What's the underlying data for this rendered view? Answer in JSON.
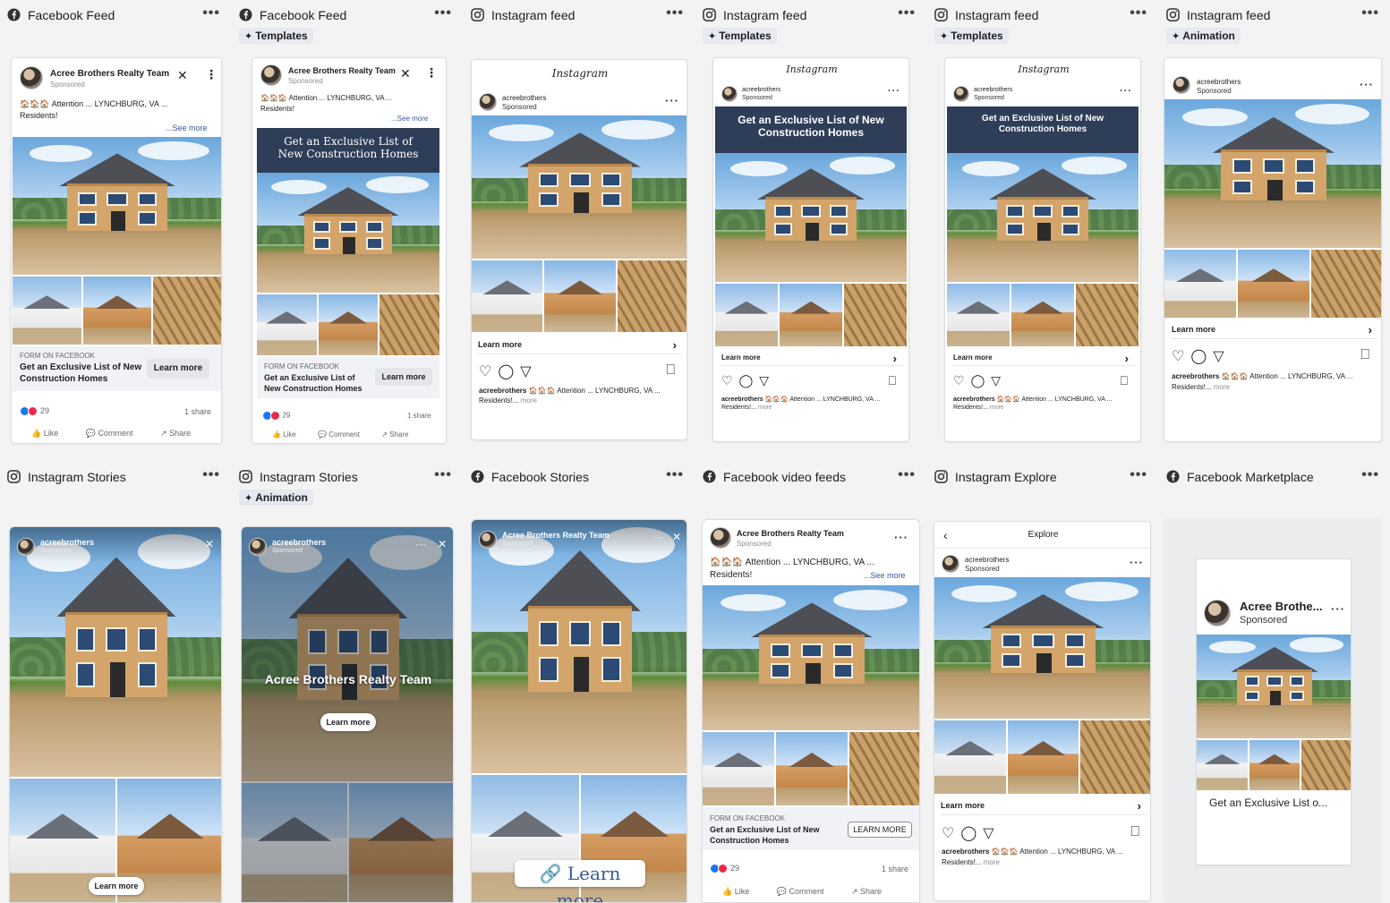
{
  "placements": [
    {
      "title": "Facebook Feed",
      "platform": "facebook",
      "tag": ""
    },
    {
      "title": "Facebook Feed",
      "platform": "facebook",
      "tag": "Templates"
    },
    {
      "title": "Instagram feed",
      "platform": "instagram",
      "tag": ""
    },
    {
      "title": "Instagram feed",
      "platform": "instagram",
      "tag": "Templates"
    },
    {
      "title": "Instagram feed",
      "platform": "instagram",
      "tag": "Templates"
    },
    {
      "title": "Instagram feed",
      "platform": "instagram",
      "tag": "Animation"
    },
    {
      "title": "Instagram Stories",
      "platform": "instagram",
      "tag": ""
    },
    {
      "title": "Instagram Stories",
      "platform": "instagram",
      "tag": "Animation"
    },
    {
      "title": "Facebook Stories",
      "platform": "facebook",
      "tag": ""
    },
    {
      "title": "Facebook video feeds",
      "platform": "facebook",
      "tag": ""
    },
    {
      "title": "Instagram Explore",
      "platform": "instagram",
      "tag": ""
    },
    {
      "title": "Facebook Marketplace",
      "platform": "facebook",
      "tag": ""
    }
  ],
  "more_glyph": "•••",
  "ad": {
    "page_name": "Acree Brothers Realty Team",
    "page_name_short": "Acree Brothe...",
    "ig_handle": "acreebrothers",
    "sponsored": "Sponsored",
    "primary_text": "Attention ... LYNCHBURG, VA ...",
    "primary_text_2": "Residents!",
    "emoji": "🏠🏠🏠",
    "see_more": "...See more",
    "ig_more": "more",
    "headline": "Get an Exclusive List of New Construction Homes",
    "headline_short": "Get an Exclusive List o...",
    "form_label": "FORM ON FACEBOOK",
    "cta": "Learn more",
    "cta_upper": "LEARN MORE",
    "reactions_count": "29",
    "shares": "1 share",
    "like": "Like",
    "comment": "Comment",
    "share": "Share",
    "ig_caption": "Attention ... LYNCHBURG, VA ...",
    "ig_caption_2": "Residents!...",
    "instagram_wordmark": "Instagram",
    "explore_title": "Explore"
  },
  "colors": {
    "facebook_blue": "#1877f2",
    "love_red": "#f02849",
    "banner_navy": "#2f3e58",
    "link_blue": "#385898",
    "panel_bg": "#f3f3f3"
  },
  "icons": {
    "facebook": "facebook-icon",
    "instagram": "instagram-icon",
    "templates": "sparkle-icon",
    "animation": "sparkle-icon",
    "close": "close-icon",
    "heart": "heart-icon",
    "comment": "comment-icon",
    "send": "send-icon",
    "bookmark": "bookmark-icon",
    "chevron_right": "chevron-right-icon",
    "chevron_left": "chevron-left-icon",
    "link": "link-icon"
  }
}
